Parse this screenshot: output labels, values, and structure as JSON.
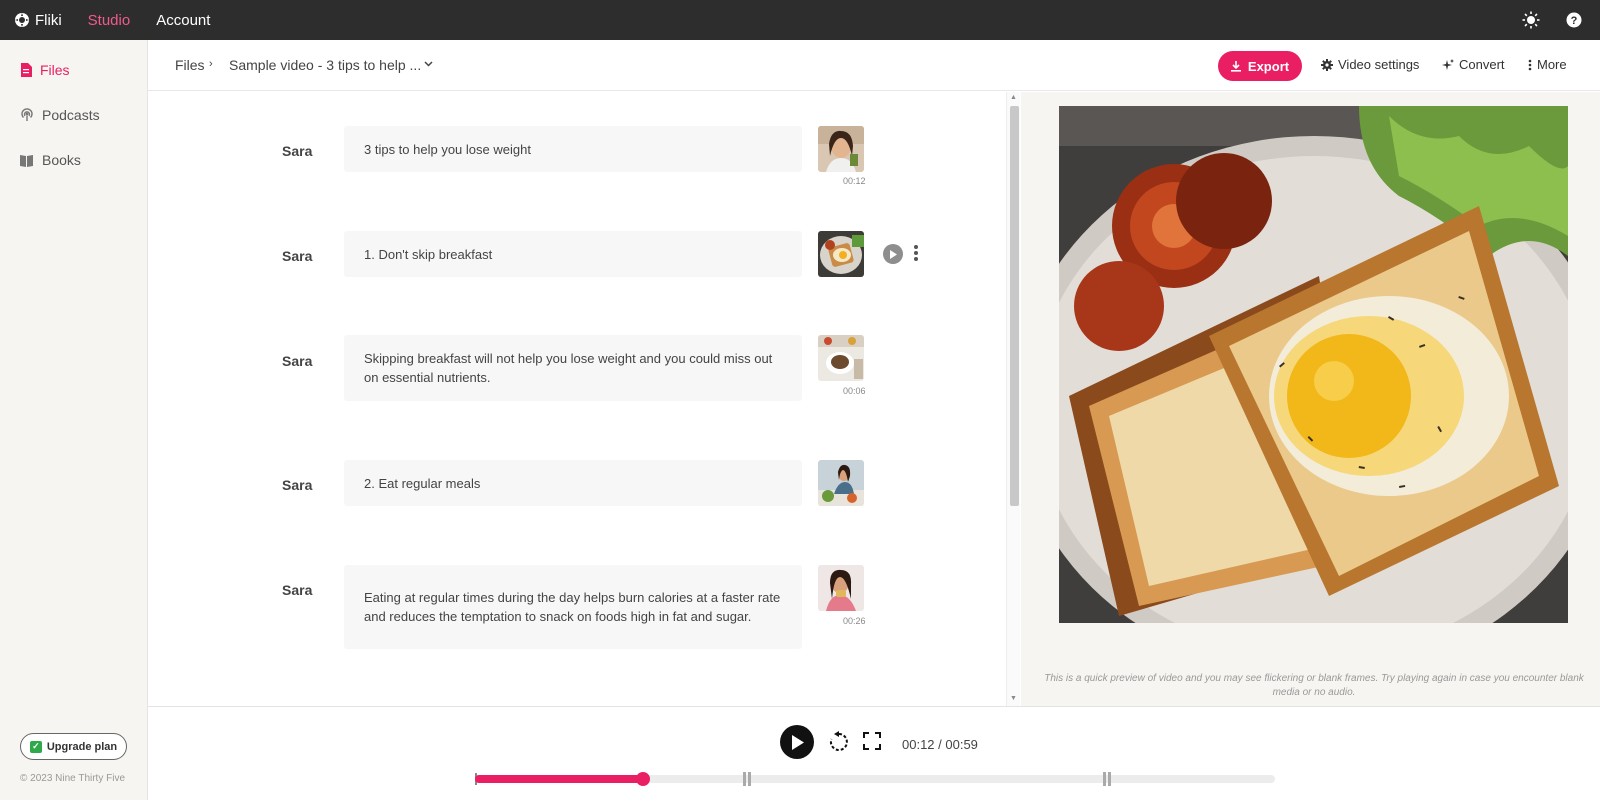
{
  "topbar": {
    "brand": "Fliki",
    "nav": [
      {
        "label": "Studio",
        "active": true
      },
      {
        "label": "Account",
        "active": false
      }
    ]
  },
  "sidebar": {
    "items": [
      {
        "label": "Files",
        "icon": "file-icon",
        "active": true
      },
      {
        "label": "Podcasts",
        "icon": "podcast-icon",
        "active": false
      },
      {
        "label": "Books",
        "icon": "book-icon",
        "active": false
      }
    ],
    "upgrade_label": "Upgrade plan",
    "copyright": "© 2023 Nine Thirty Five"
  },
  "header": {
    "breadcrumb_root": "Files",
    "breadcrumb_current": "Sample video - 3 tips to help ...",
    "export_label": "Export",
    "video_settings_label": "Video settings",
    "convert_label": "Convert",
    "more_label": "More"
  },
  "scenes": [
    {
      "speaker": "Sara",
      "text": "3 tips to help you lose weight",
      "duration": "00:12",
      "thumb": "woman-smiling"
    },
    {
      "speaker": "Sara",
      "text": "1. Don't skip breakfast",
      "duration": "",
      "thumb": "breakfast-plate"
    },
    {
      "speaker": "Sara",
      "text": "Skipping breakfast will not help you lose weight and you could miss out on essential nutrients.",
      "duration": "00:06",
      "thumb": "coffee-table"
    },
    {
      "speaker": "Sara",
      "text": "2. Eat regular meals",
      "duration": "",
      "thumb": "woman-cooking"
    },
    {
      "speaker": "Sara",
      "text": "Eating at regular times during the day helps burn calories at a faster rate and reduces the temptation to snack on foods high in fat and sugar.",
      "duration": "00:26",
      "thumb": "woman-eating"
    }
  ],
  "preview": {
    "note": "This is a quick preview of video and you may see flickering or blank frames. Try playing again in case you encounter blank media or no audio."
  },
  "player": {
    "time_readout": "00:12 / 00:59",
    "progress_fraction": 0.21,
    "section_markers_fraction": [
      0.21,
      0.34,
      0.79
    ]
  },
  "colors": {
    "accent": "#e91e63",
    "topbar": "#2d2d2d",
    "sidebar": "#f6f5f2"
  }
}
